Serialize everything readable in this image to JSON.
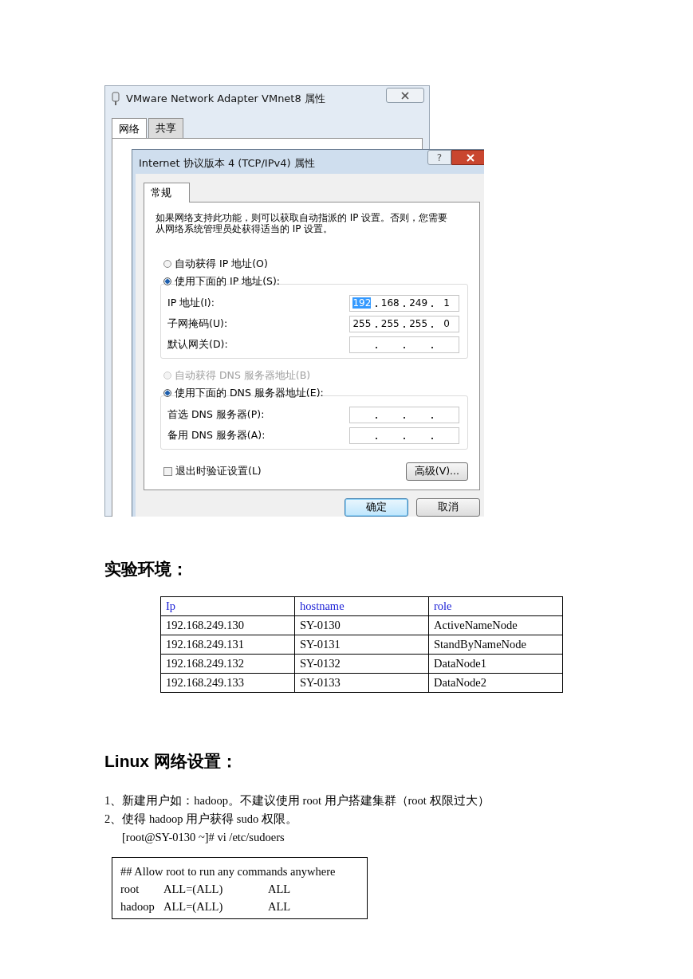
{
  "screenshot": {
    "back_window": {
      "title": "VMware Network Adapter VMnet8 属性",
      "tabs": [
        {
          "label": "网络",
          "selected": true
        },
        {
          "label": "共享",
          "selected": false
        }
      ]
    },
    "dialog": {
      "title": "Internet 协议版本 4 (TCP/IPv4) 属性",
      "help": "?",
      "tabs": [
        {
          "label": "常规",
          "selected": true
        }
      ],
      "description": "如果网络支持此功能，则可以获取自动指派的 IP 设置。否则，您需要从网络系统管理员处获得适当的 IP 设置。",
      "ip_radios": [
        {
          "label": "自动获得 IP 地址(O)",
          "selected": false,
          "disabled": false
        },
        {
          "label": "使用下面的 IP 地址(S):",
          "selected": true,
          "disabled": false
        }
      ],
      "ip_fields": [
        {
          "label": "IP 地址(I):",
          "octets": [
            {
              "value": "192",
              "selected": true
            },
            {
              "value": "168",
              "selected": false
            },
            {
              "value": "249",
              "selected": false
            },
            {
              "value": "1",
              "selected": false
            }
          ]
        },
        {
          "label": "子网掩码(U):",
          "octets": [
            {
              "value": "255",
              "selected": false
            },
            {
              "value": "255",
              "selected": false
            },
            {
              "value": "255",
              "selected": false
            },
            {
              "value": "0",
              "selected": false
            }
          ]
        },
        {
          "label": "默认网关(D):"
        }
      ],
      "dns_radios": [
        {
          "label": "自动获得 DNS 服务器地址(B)",
          "selected": false,
          "disabled": true
        },
        {
          "label": "使用下面的 DNS 服务器地址(E):",
          "selected": true,
          "disabled": false
        }
      ],
      "dns_fields": [
        {
          "label": "首选 DNS 服务器(P):"
        },
        {
          "label": "备用 DNS 服务器(A):"
        }
      ],
      "validate_checkbox": {
        "label": "退出时验证设置(L)",
        "checked": false
      },
      "advanced_button": "高级(V)...",
      "buttons": [
        {
          "label": "确定",
          "default": true
        },
        {
          "label": "取消",
          "default": false
        }
      ]
    }
  },
  "env_heading": "实验环境：",
  "env_table": {
    "columns": [
      "Ip",
      "hostname",
      "role"
    ],
    "rows": [
      [
        "192.168.249.130",
        "SY-0130",
        "ActiveNameNode"
      ],
      [
        "192.168.249.131",
        "SY-0131",
        "StandByNameNode"
      ],
      [
        "192.168.249.132",
        "SY-0132",
        "DataNode1"
      ],
      [
        "192.168.249.133",
        "SY-0133",
        "DataNode2"
      ]
    ]
  },
  "linux_heading": "Linux 网络设置：",
  "steps": [
    "1、新建用户如：hadoop。不建议使用 root 用户搭建集群（root 权限过大）",
    "2、使得 hadoop 用户获得 sudo 权限。"
  ],
  "command": "[root@SY-0130 ~]# vi /etc/sudoers",
  "code_box": {
    "comment": "## Allow root to run any commands anywhere",
    "rows": [
      [
        "root",
        "ALL=(ALL)",
        "ALL"
      ],
      [
        "hadoop",
        "ALL=(ALL)",
        "ALL"
      ]
    ]
  }
}
